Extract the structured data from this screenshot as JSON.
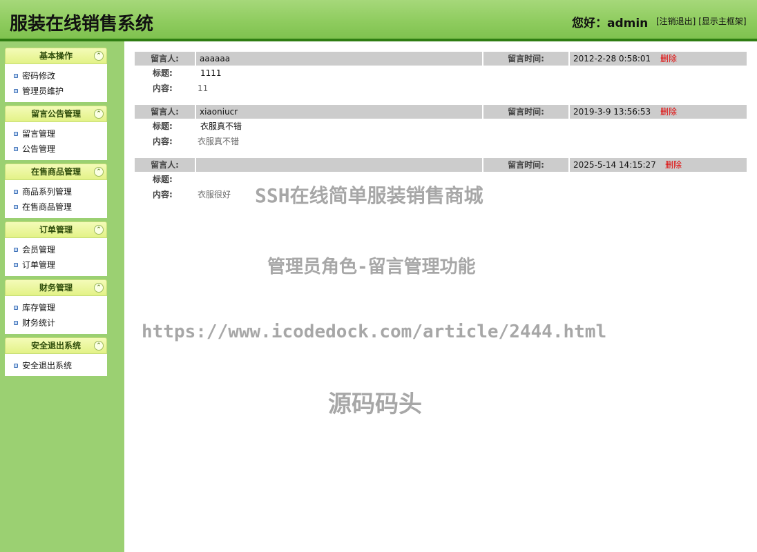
{
  "header": {
    "title": "服装在线销售系统",
    "greeting": "您好：admin",
    "logout_label": "[注销退出]",
    "show_frame_label": "[显示主框架]"
  },
  "sidebar": {
    "sections": [
      {
        "title": "基本操作",
        "items": [
          "密码修改",
          "管理员维护"
        ]
      },
      {
        "title": "留言公告管理",
        "items": [
          "留言管理",
          "公告管理"
        ]
      },
      {
        "title": "在售商品管理",
        "items": [
          "商品系列管理",
          "在售商品管理"
        ]
      },
      {
        "title": "订单管理",
        "items": [
          "会员管理",
          "订单管理"
        ]
      },
      {
        "title": "财务管理",
        "items": [
          "库存管理",
          "财务统计"
        ]
      },
      {
        "title": "安全退出系统",
        "items": [
          "安全退出系统"
        ]
      }
    ],
    "toggle_glyph": "⌃"
  },
  "labels": {
    "author": "留言人:",
    "time": "留言时间:",
    "subject": "标题:",
    "content": "内容:",
    "delete": "删除"
  },
  "messages": [
    {
      "author": "aaaaaa",
      "time": "2012-2-28 0:58:01",
      "subject": "1111",
      "content": "11"
    },
    {
      "author": "xiaoniucr",
      "time": "2019-3-9 13:56:53",
      "subject": "衣服真不错",
      "content": "衣服真不错"
    },
    {
      "author": "",
      "time": "2025-5-14 14:15:27",
      "subject": "",
      "content": "衣服很好"
    }
  ],
  "watermark": {
    "line1": "SSH在线简单服装销售商城",
    "line2": "管理员角色-留言管理功能",
    "line3": "https://www.icodedock.com/article/2444.html",
    "line4": "源码码头"
  }
}
